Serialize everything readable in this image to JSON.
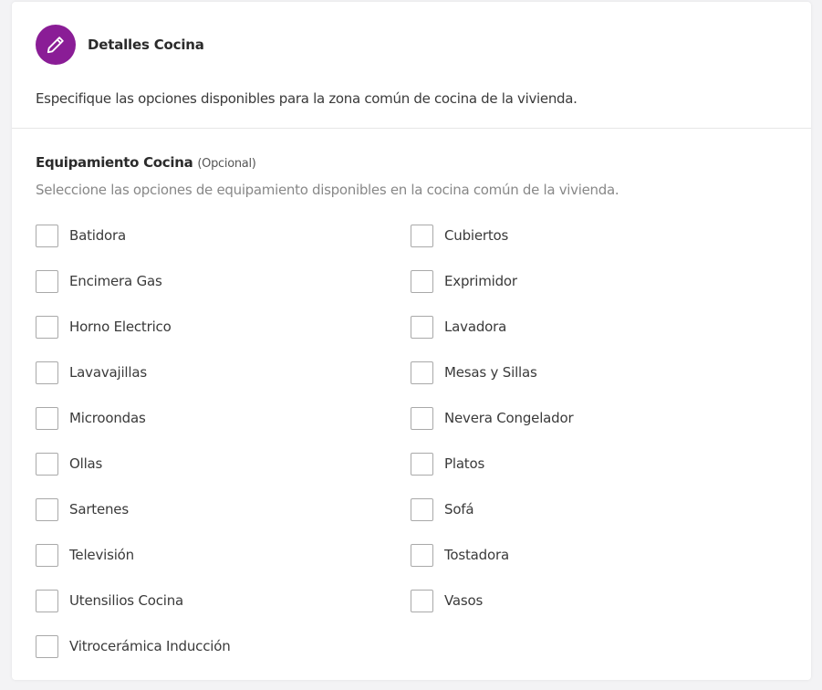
{
  "header": {
    "title": "Detalles Cocina",
    "icon": "pencil-icon",
    "accent_color": "#8a1d96"
  },
  "description": "Especifique las opciones disponibles para la zona común de cocina de la vivienda.",
  "field": {
    "label": "Equipamiento Cocina",
    "optional_label": "(Opcional)",
    "help_text": "Seleccione las opciones de equipamiento disponibles en la cocina común de la vivienda."
  },
  "options": [
    {
      "label": "Batidora",
      "checked": false
    },
    {
      "label": "Cubiertos",
      "checked": false
    },
    {
      "label": "Encimera Gas",
      "checked": false
    },
    {
      "label": "Exprimidor",
      "checked": false
    },
    {
      "label": "Horno Electrico",
      "checked": false
    },
    {
      "label": "Lavadora",
      "checked": false
    },
    {
      "label": "Lavavajillas",
      "checked": false
    },
    {
      "label": "Mesas y Sillas",
      "checked": false
    },
    {
      "label": "Microondas",
      "checked": false
    },
    {
      "label": "Nevera Congelador",
      "checked": false
    },
    {
      "label": "Ollas",
      "checked": false
    },
    {
      "label": "Platos",
      "checked": false
    },
    {
      "label": "Sartenes",
      "checked": false
    },
    {
      "label": "Sofá",
      "checked": false
    },
    {
      "label": "Televisión",
      "checked": false
    },
    {
      "label": "Tostadora",
      "checked": false
    },
    {
      "label": "Utensilios Cocina",
      "checked": false
    },
    {
      "label": "Vasos",
      "checked": false
    },
    {
      "label": "Vitrocerámica Inducción",
      "checked": false
    }
  ]
}
